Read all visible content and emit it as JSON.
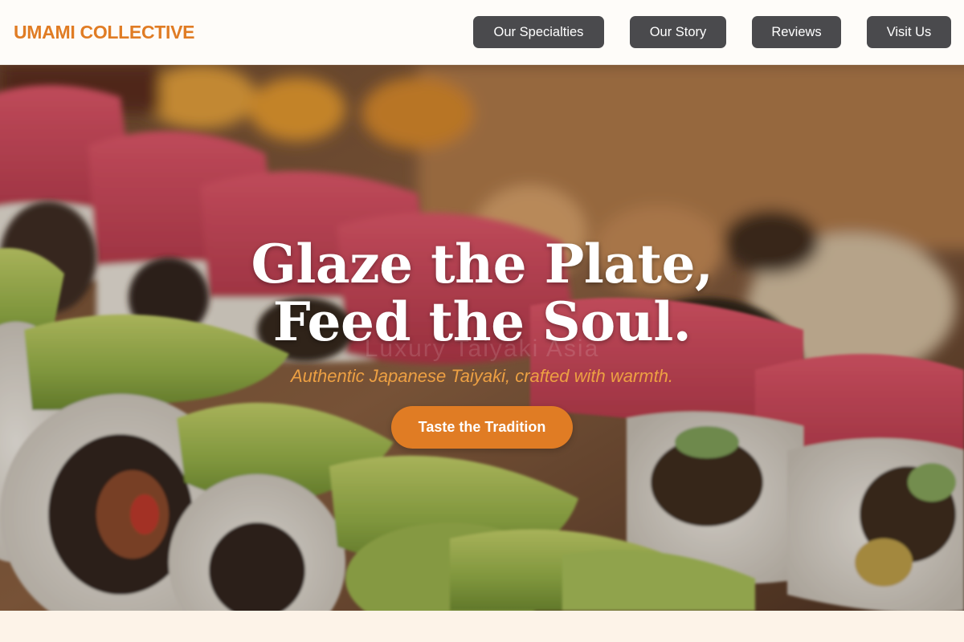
{
  "header": {
    "brand": "UMAMI COLLECTIVE",
    "nav": [
      {
        "label": "Our Specialties"
      },
      {
        "label": "Our Story"
      },
      {
        "label": "Reviews"
      },
      {
        "label": "Visit Us"
      }
    ]
  },
  "hero": {
    "image": "sushi-rolls-photo",
    "headline_line1": "Glaze the Plate,",
    "headline_line2": "Feed the Soul.",
    "watermark": "Luxury Taiyaki Asia",
    "subtitle": "Authentic Japanese Taiyaki, crafted with warmth.",
    "cta_label": "Taste the Tradition"
  },
  "colors": {
    "accent": "#e07c24",
    "nav_button": "#4a4a4d",
    "header_bg": "#fefcf9",
    "page_bg": "#fdf3e8"
  }
}
